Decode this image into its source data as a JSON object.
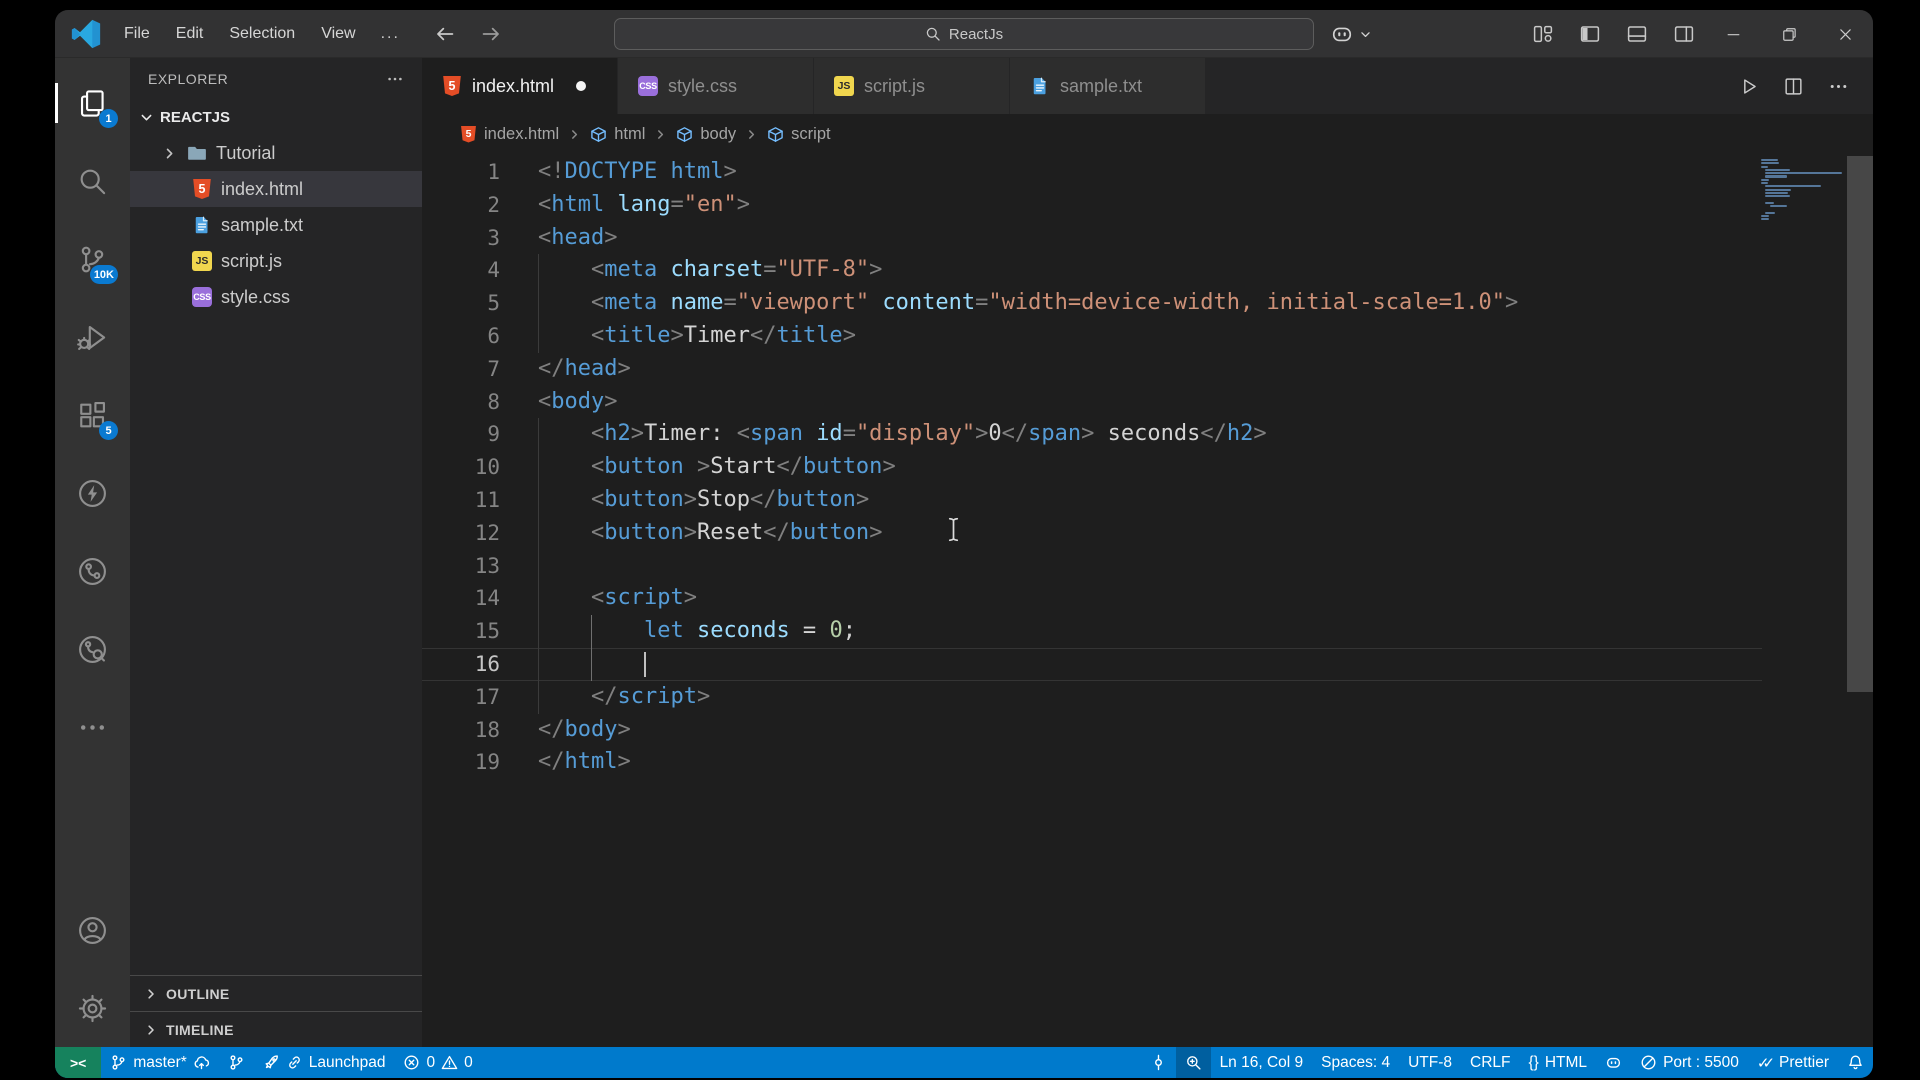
{
  "colors": {
    "statusbar_bg": "#007acc",
    "remote_bg": "#16825d",
    "titlebar_bg": "#323233",
    "activitybar_bg": "#333333",
    "sidebar_bg": "#252526",
    "editor_bg": "#1e1e1e",
    "tab_inactive_bg": "#2d2d2d",
    "badge_bg": "#0a7ad1",
    "selected_row_bg": "#37373d"
  },
  "titlebar": {
    "menus": [
      "File",
      "Edit",
      "Selection",
      "View"
    ],
    "menu_overflow": "...",
    "search": {
      "value": "ReactJs",
      "icon": "search"
    },
    "copilot_icon": "copilot",
    "layout_icons": [
      "layout-grid",
      "layout-sidebar",
      "layout-panel",
      "layout-sidebar-right"
    ],
    "window_controls": [
      "minimize",
      "restore",
      "close"
    ]
  },
  "activitybar": {
    "top": [
      {
        "name": "explorer",
        "icon": "files",
        "badge": "1",
        "active": true
      },
      {
        "name": "search",
        "icon": "search"
      },
      {
        "name": "source-control",
        "icon": "branch",
        "badge": "10K"
      },
      {
        "name": "run-and-debug",
        "icon": "debug"
      },
      {
        "name": "extensions",
        "icon": "extensions",
        "badge": "5"
      },
      {
        "name": "thunder-client",
        "icon": "zap"
      },
      {
        "name": "live-share",
        "icon": "circle-fork"
      },
      {
        "name": "code-inspect",
        "icon": "circle-fork-search"
      },
      {
        "name": "additional-views",
        "icon": "ellipsis"
      }
    ],
    "bottom": [
      {
        "name": "accounts",
        "icon": "account"
      },
      {
        "name": "settings",
        "icon": "gear"
      }
    ]
  },
  "sidebar": {
    "title": "EXPLORER",
    "title_more": "ellipsis",
    "root": "REACTJS",
    "items": [
      {
        "label": "Tutorial",
        "icon": "folder",
        "type": "folder",
        "chevron": "chev-right"
      },
      {
        "label": "index.html",
        "icon": "html",
        "selected": true
      },
      {
        "label": "sample.txt",
        "icon": "txt"
      },
      {
        "label": "script.js",
        "icon": "js"
      },
      {
        "label": "style.css",
        "icon": "css"
      }
    ],
    "sections": [
      "OUTLINE",
      "TIMELINE"
    ]
  },
  "tabs": [
    {
      "label": "index.html",
      "icon": "html",
      "active": true,
      "modified": true
    },
    {
      "label": "style.css",
      "icon": "css"
    },
    {
      "label": "script.js",
      "icon": "js"
    },
    {
      "label": "sample.txt",
      "icon": "txt"
    }
  ],
  "editor_actions": [
    {
      "name": "run-file",
      "icon": "play"
    },
    {
      "name": "split-editor",
      "icon": "split"
    },
    {
      "name": "more-actions",
      "icon": "ellipsis"
    }
  ],
  "breadcrumb": [
    {
      "icon": "html",
      "label": "index.html"
    },
    {
      "icon": "cube",
      "label": "html"
    },
    {
      "icon": "cube",
      "label": "body"
    },
    {
      "icon": "cube",
      "label": "script"
    }
  ],
  "editor": {
    "active_line": 16,
    "cursor": {
      "line": 16,
      "col": 9
    },
    "lines": [
      {
        "n": 1,
        "g": [],
        "t": [
          [
            "p",
            "<!"
          ],
          [
            "t",
            "DOCTYPE"
          ],
          [
            "t",
            " html"
          ],
          [
            "p",
            ">"
          ]
        ]
      },
      {
        "n": 2,
        "g": [],
        "t": [
          [
            "p",
            "<"
          ],
          [
            "t",
            "html"
          ],
          [
            "x",
            " "
          ],
          [
            "a",
            "lang"
          ],
          [
            "p",
            "="
          ],
          [
            "s",
            "\"en\""
          ],
          [
            "p",
            ">"
          ]
        ]
      },
      {
        "n": 3,
        "g": [],
        "t": [
          [
            "p",
            "<"
          ],
          [
            "t",
            "head"
          ],
          [
            "p",
            ">"
          ]
        ]
      },
      {
        "n": 4,
        "g": [
          [
            0,
            0
          ]
        ],
        "t": [
          [
            "x",
            "    "
          ],
          [
            "p",
            "<"
          ],
          [
            "t",
            "meta"
          ],
          [
            "x",
            " "
          ],
          [
            "a",
            "charset"
          ],
          [
            "p",
            "="
          ],
          [
            "s",
            "\"UTF-8\""
          ],
          [
            "p",
            ">"
          ]
        ]
      },
      {
        "n": 5,
        "g": [
          [
            0,
            0
          ]
        ],
        "t": [
          [
            "x",
            "    "
          ],
          [
            "p",
            "<"
          ],
          [
            "t",
            "meta"
          ],
          [
            "x",
            " "
          ],
          [
            "a",
            "name"
          ],
          [
            "p",
            "="
          ],
          [
            "s",
            "\"viewport\""
          ],
          [
            "x",
            " "
          ],
          [
            "a",
            "content"
          ],
          [
            "p",
            "="
          ],
          [
            "s",
            "\"width=device-width, initial-scale=1.0\""
          ],
          [
            "p",
            ">"
          ]
        ]
      },
      {
        "n": 6,
        "g": [
          [
            0,
            0
          ]
        ],
        "t": [
          [
            "x",
            "    "
          ],
          [
            "p",
            "<"
          ],
          [
            "t",
            "title"
          ],
          [
            "p",
            ">"
          ],
          [
            "x",
            "Timer"
          ],
          [
            "p",
            "</"
          ],
          [
            "t",
            "title"
          ],
          [
            "p",
            ">"
          ]
        ]
      },
      {
        "n": 7,
        "g": [],
        "t": [
          [
            "p",
            "</"
          ],
          [
            "t",
            "head"
          ],
          [
            "p",
            ">"
          ]
        ]
      },
      {
        "n": 8,
        "g": [],
        "t": [
          [
            "p",
            "<"
          ],
          [
            "t",
            "body"
          ],
          [
            "p",
            ">"
          ]
        ]
      },
      {
        "n": 9,
        "g": [
          [
            0,
            0
          ]
        ],
        "t": [
          [
            "x",
            "    "
          ],
          [
            "p",
            "<"
          ],
          [
            "t",
            "h2"
          ],
          [
            "p",
            ">"
          ],
          [
            "x",
            "Timer: "
          ],
          [
            "p",
            "<"
          ],
          [
            "t",
            "span"
          ],
          [
            "x",
            " "
          ],
          [
            "a",
            "id"
          ],
          [
            "p",
            "="
          ],
          [
            "s",
            "\"display\""
          ],
          [
            "p",
            ">"
          ],
          [
            "x",
            "0"
          ],
          [
            "p",
            "</"
          ],
          [
            "t",
            "span"
          ],
          [
            "p",
            ">"
          ],
          [
            "x",
            " seconds"
          ],
          [
            "p",
            "</"
          ],
          [
            "t",
            "h2"
          ],
          [
            "p",
            ">"
          ]
        ]
      },
      {
        "n": 10,
        "g": [
          [
            0,
            0
          ]
        ],
        "t": [
          [
            "x",
            "    "
          ],
          [
            "p",
            "<"
          ],
          [
            "t",
            "button"
          ],
          [
            "x",
            " "
          ],
          [
            "p",
            ">"
          ],
          [
            "x",
            "Start"
          ],
          [
            "p",
            "</"
          ],
          [
            "t",
            "button"
          ],
          [
            "p",
            ">"
          ]
        ]
      },
      {
        "n": 11,
        "g": [
          [
            0,
            0
          ]
        ],
        "t": [
          [
            "x",
            "    "
          ],
          [
            "p",
            "<"
          ],
          [
            "t",
            "button"
          ],
          [
            "p",
            ">"
          ],
          [
            "x",
            "Stop"
          ],
          [
            "p",
            "</"
          ],
          [
            "t",
            "button"
          ],
          [
            "p",
            ">"
          ]
        ]
      },
      {
        "n": 12,
        "g": [
          [
            0,
            0
          ]
        ],
        "t": [
          [
            "x",
            "    "
          ],
          [
            "p",
            "<"
          ],
          [
            "t",
            "button"
          ],
          [
            "p",
            ">"
          ],
          [
            "x",
            "Reset"
          ],
          [
            "p",
            "</"
          ],
          [
            "t",
            "button"
          ],
          [
            "p",
            ">"
          ]
        ]
      },
      {
        "n": 13,
        "g": [
          [
            0,
            0
          ]
        ],
        "t": []
      },
      {
        "n": 14,
        "g": [
          [
            0,
            0
          ]
        ],
        "t": [
          [
            "x",
            "    "
          ],
          [
            "p",
            "<"
          ],
          [
            "t",
            "script"
          ],
          [
            "p",
            ">"
          ]
        ]
      },
      {
        "n": 15,
        "g": [
          [
            0,
            0
          ],
          [
            1,
            1
          ]
        ],
        "t": [
          [
            "x",
            "        "
          ],
          [
            "t",
            "let"
          ],
          [
            "x",
            " "
          ],
          [
            "a",
            "seconds"
          ],
          [
            "x",
            " = "
          ],
          [
            "n",
            "0"
          ],
          [
            "x",
            ";"
          ]
        ]
      },
      {
        "n": 16,
        "g": [
          [
            0,
            0
          ],
          [
            1,
            1
          ]
        ],
        "t": []
      },
      {
        "n": 17,
        "g": [
          [
            0,
            0
          ]
        ],
        "t": [
          [
            "x",
            "    "
          ],
          [
            "p",
            "</"
          ],
          [
            "t",
            "script"
          ],
          [
            "p",
            ">"
          ]
        ]
      },
      {
        "n": 18,
        "g": [],
        "t": [
          [
            "p",
            "</"
          ],
          [
            "t",
            "body"
          ],
          [
            "p",
            ">"
          ]
        ]
      },
      {
        "n": 19,
        "g": [],
        "t": [
          [
            "p",
            "</"
          ],
          [
            "t",
            "html"
          ],
          [
            "p",
            ">"
          ]
        ]
      }
    ]
  },
  "statusbar": {
    "left": [
      {
        "name": "remote-indicator",
        "cls": "remote",
        "parts": [
          {
            "text": "><"
          }
        ]
      },
      {
        "name": "git-branch-status",
        "parts": [
          {
            "icon": "branch"
          },
          {
            "text": "master*"
          },
          {
            "icon": "cloud-upload"
          }
        ]
      },
      {
        "name": "source-control-graph",
        "parts": [
          {
            "icon": "branch"
          }
        ]
      },
      {
        "name": "launchpad",
        "parts": [
          {
            "icon": "rocket"
          },
          {
            "icon": "link"
          },
          {
            "text": "Launchpad"
          }
        ]
      },
      {
        "name": "problems",
        "parts": [
          {
            "icon": "error"
          },
          {
            "text": "0"
          },
          {
            "icon": "warning"
          },
          {
            "text": "0"
          }
        ]
      }
    ],
    "right": [
      {
        "name": "commit-indicator",
        "parts": [
          {
            "icon": "commit"
          }
        ]
      },
      {
        "name": "zoom-indicator",
        "cls": "dim",
        "parts": [
          {
            "icon": "zoom-in"
          }
        ]
      },
      {
        "name": "cursor-position",
        "parts": [
          {
            "text": "Ln 16, Col 9"
          }
        ]
      },
      {
        "name": "indentation",
        "parts": [
          {
            "text": "Spaces: 4"
          }
        ]
      },
      {
        "name": "encoding",
        "parts": [
          {
            "text": "UTF-8"
          }
        ]
      },
      {
        "name": "eol-sequence",
        "parts": [
          {
            "text": "CRLF"
          }
        ]
      },
      {
        "name": "language-mode",
        "parts": [
          {
            "text": "{}"
          },
          {
            "text": "HTML"
          }
        ]
      },
      {
        "name": "copilot-status",
        "parts": [
          {
            "icon": "copilot"
          }
        ]
      },
      {
        "name": "live-server-port",
        "parts": [
          {
            "icon": "circle-slash"
          },
          {
            "text": "Port : 5500"
          }
        ]
      },
      {
        "name": "prettier",
        "parts": [
          {
            "check": "✓✓"
          },
          {
            "text": "Prettier"
          }
        ]
      },
      {
        "name": "notifications",
        "parts": [
          {
            "icon": "bell"
          }
        ]
      }
    ]
  }
}
